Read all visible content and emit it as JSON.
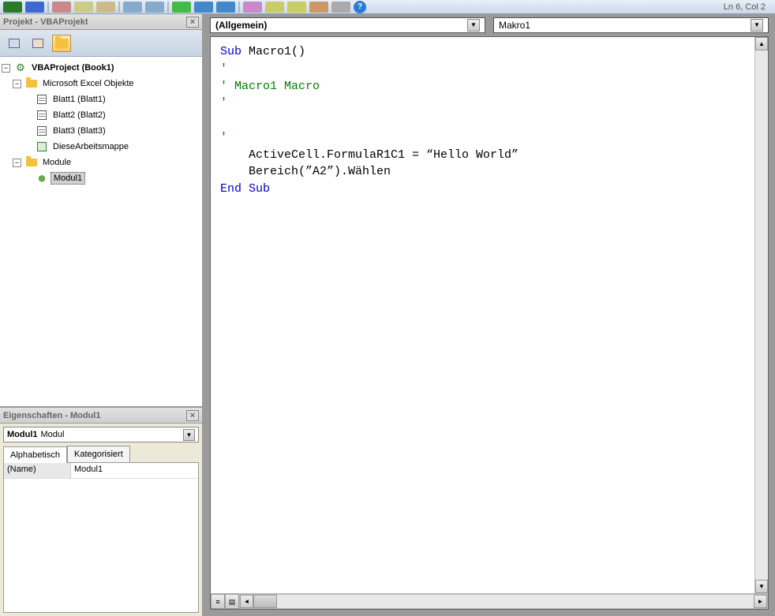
{
  "status": {
    "cursor_pos": "Ln 6, Col 2"
  },
  "project_pane": {
    "title": "Projekt - VBAProjekt",
    "tree": {
      "root": "VBAProject (Book1)",
      "objects_folder": "Microsoft Excel Objekte",
      "sheets": [
        "Blatt1 (Blatt1)",
        "Blatt2 (Blatt2)",
        "Blatt3 (Blatt3)"
      ],
      "workbook": "DieseArbeitsmappe",
      "modules_folder": "Module",
      "module": "Modul1"
    }
  },
  "props_pane": {
    "title": "Eigenschaften - Modul1",
    "object_name": "Modul1",
    "object_type": "Modul",
    "tabs": {
      "alpha": "Alphabetisch",
      "cat": "Kategorisiert"
    },
    "rows": [
      {
        "key": "(Name)",
        "val": "Modul1"
      }
    ]
  },
  "code_pane": {
    "left_combo": "(Allgemein)",
    "right_combo": "Makro1",
    "lines": [
      {
        "t": "Sub Macro1()",
        "kw": [
          "Sub"
        ]
      },
      {
        "t": "'",
        "c": true
      },
      {
        "t": "' Macro1 Macro",
        "c": true
      },
      {
        "t": "'",
        "c": true
      },
      {
        "t": ""
      },
      {
        "t": "'",
        "c": true
      },
      {
        "t": "    ActiveCell.FormulaR1C1 = “Hello World”"
      },
      {
        "t": "    Bereich(”A2”).Wählen"
      },
      {
        "t": "End Sub",
        "kw": [
          "End",
          "Sub"
        ]
      }
    ]
  }
}
